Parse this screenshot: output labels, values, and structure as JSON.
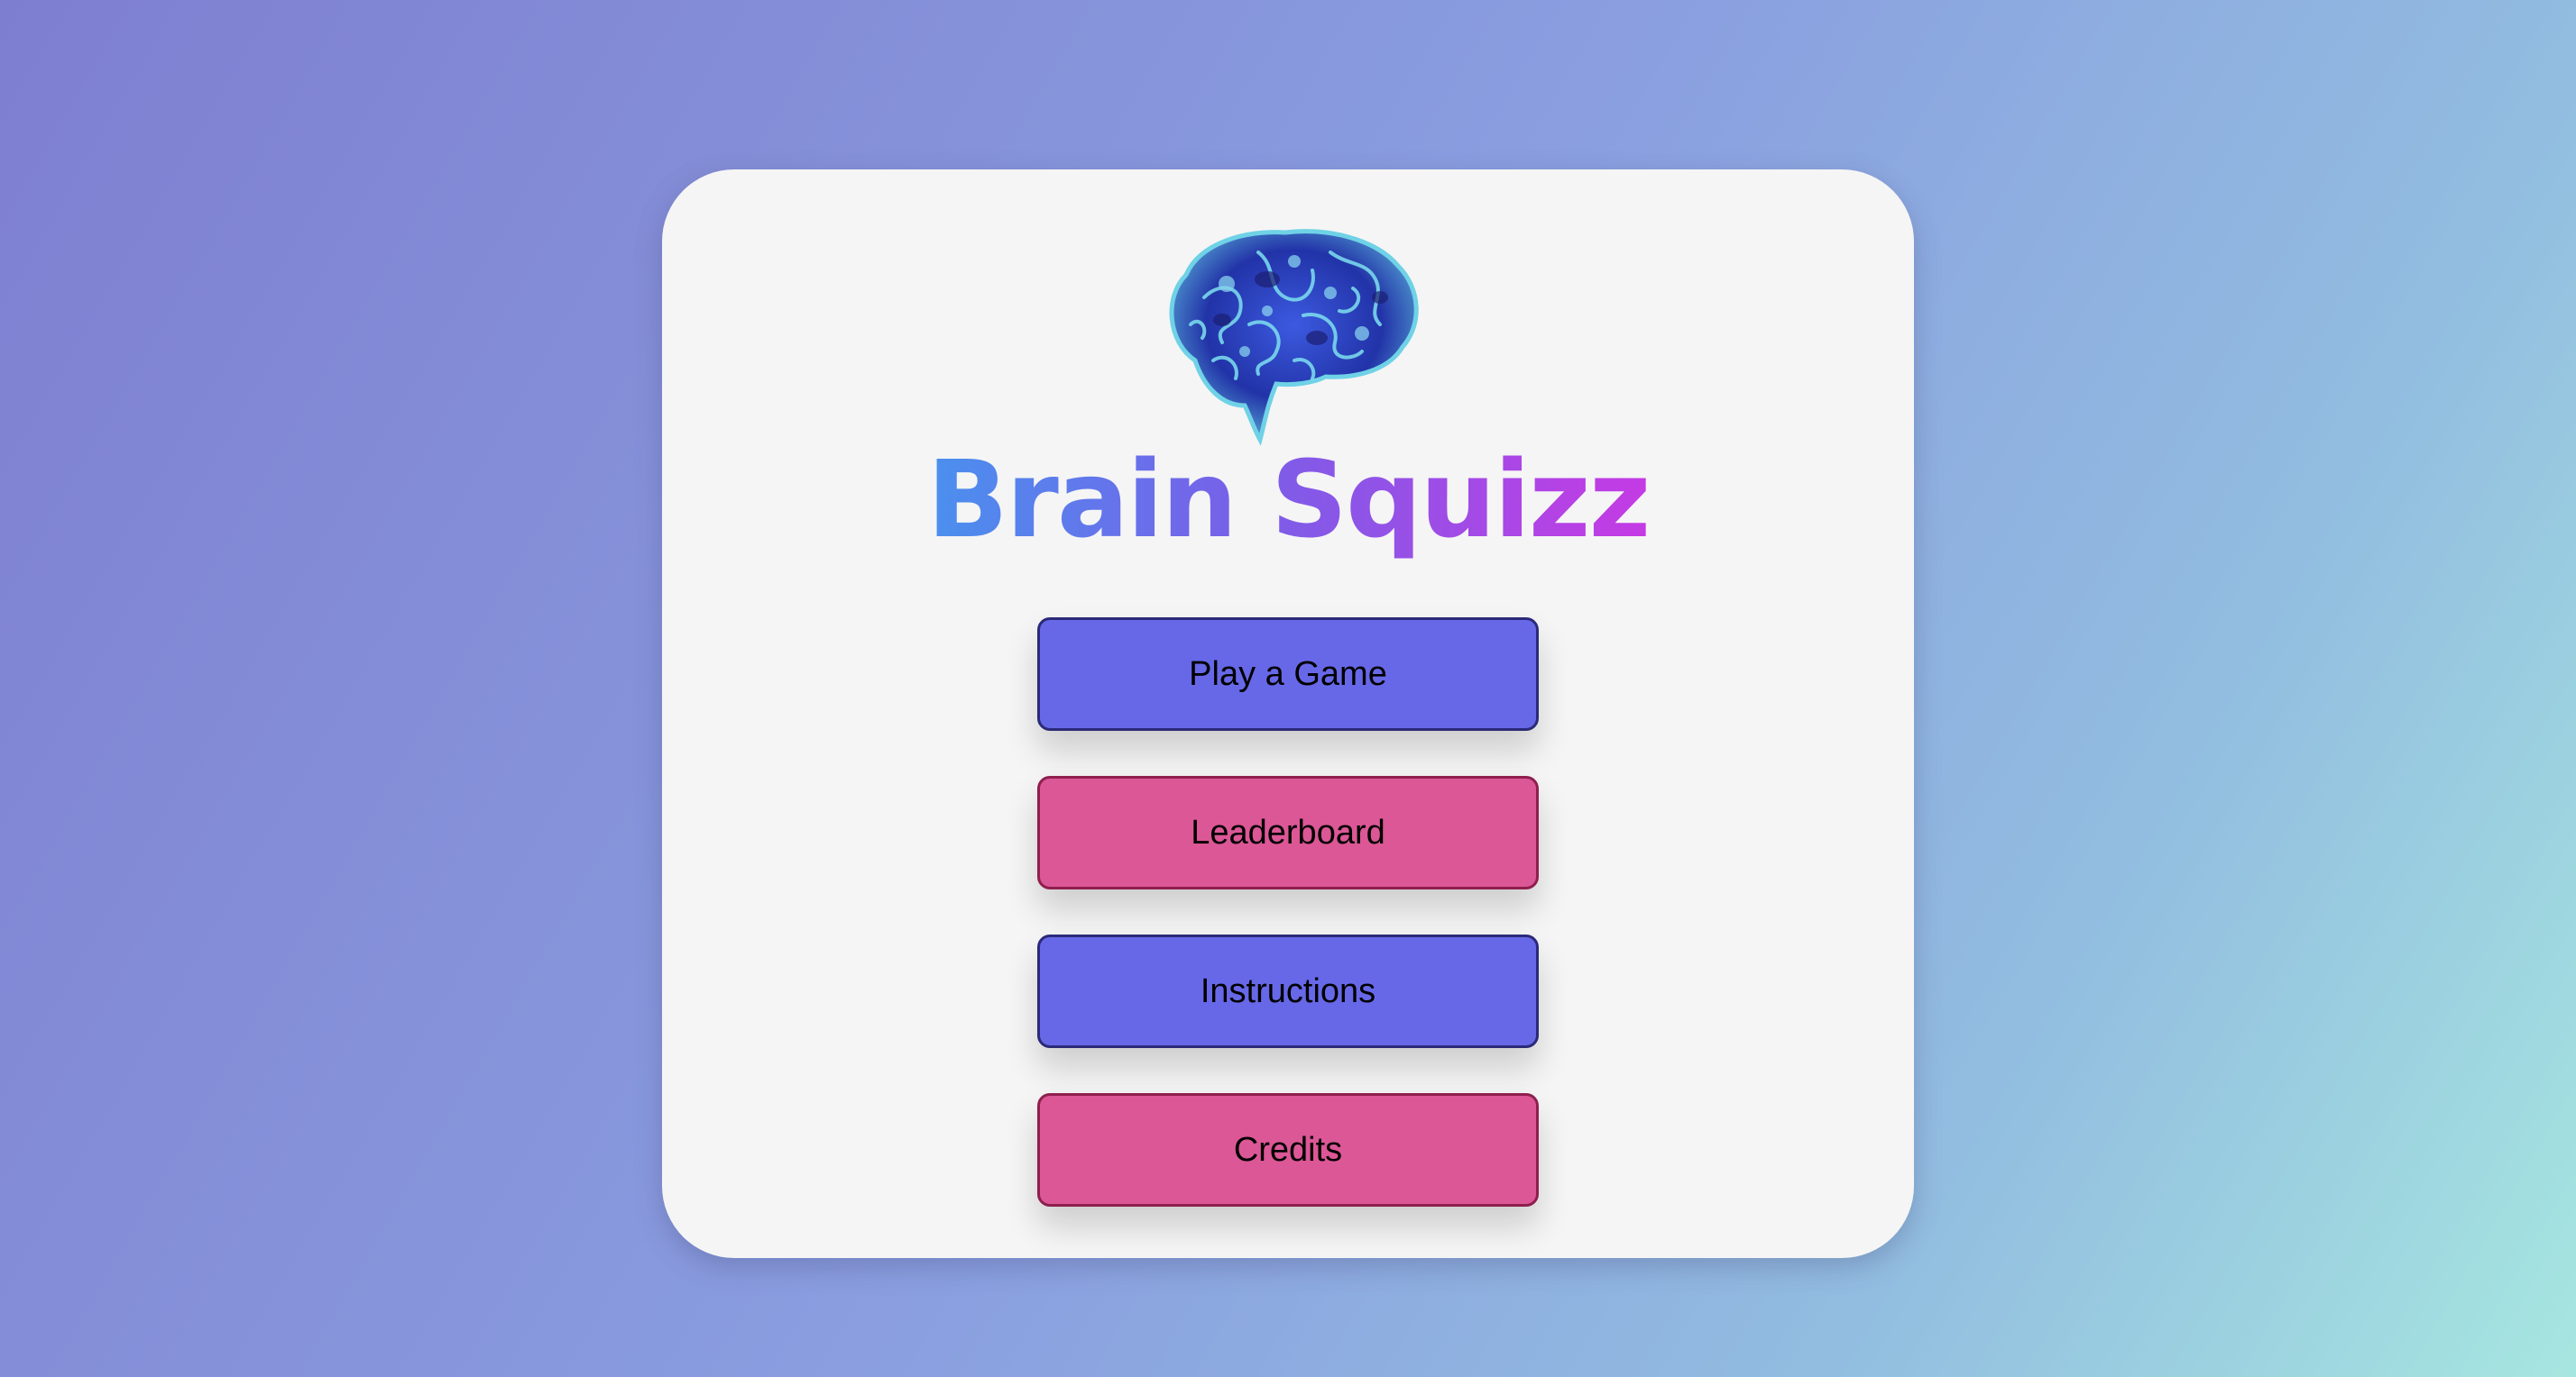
{
  "app": {
    "title": "Brain Squizz",
    "logo_icon": "brain-icon"
  },
  "menu": {
    "play_label": "Play a Game",
    "leaderboard_label": "Leaderboard",
    "instructions_label": "Instructions",
    "credits_label": "Credits"
  },
  "colors": {
    "primary_button": "#6768e8",
    "secondary_button": "#db5796",
    "title_gradient_start": "#4a90ee",
    "title_gradient_end": "#c53ae4"
  }
}
